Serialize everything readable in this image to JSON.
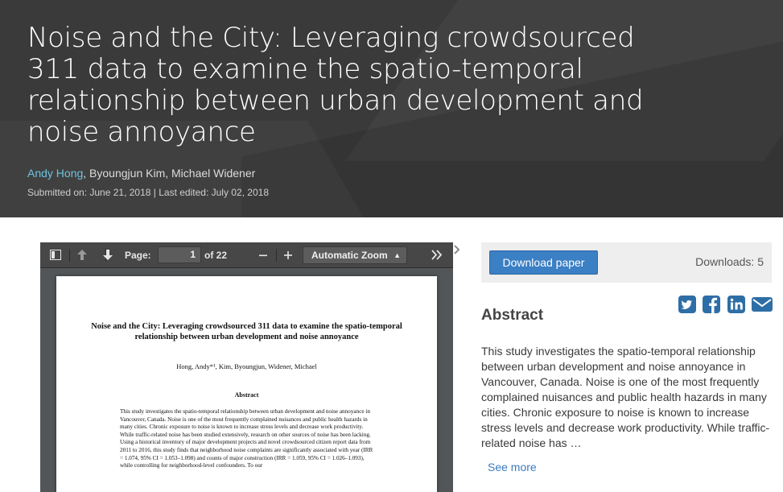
{
  "paper": {
    "title": "Noise and the City: Leveraging crowdsourced 311 data to examine the spatio-temporal relationship between urban development and noise annoyance",
    "authors_lead": "Andy Hong",
    "authors_rest": ", Byoungjun Kim, Michael Widener",
    "submitted": "Submitted on: June 21, 2018 | Last edited: July 02, 2018"
  },
  "viewer": {
    "page_label": "Page:",
    "page_value": "1",
    "page_total": "of 22",
    "zoom": "Automatic Zoom",
    "icons": [
      "sidebar-toggle-icon",
      "previous-page-icon",
      "next-page-icon",
      "zoom-out-icon",
      "zoom-in-icon",
      "tools-icon"
    ]
  },
  "pdf": {
    "title": "Noise and the City: Leveraging crowdsourced 311 data to examine the spatio-temporal relationship between urban development and noise annoyance",
    "authors": "Hong, Andy*¹, Kim, Byoungjun, Widener, Michael",
    "abstract_heading": "Abstract",
    "abstract_body": "This study investigates the spatio-temporal relationship between urban development and noise annoyance in Vancouver, Canada. Noise is one of the most frequently complained nuisances and public health hazards in many cities. Chronic exposure to noise is known to increase stress levels and decrease work productivity. While traffic-related noise has been studied extensively, research on other sources of noise has been lacking. Using a historical inventory of major development projects and novel crowdsourced citizen report data from 2011 to 2016, this study finds that neighborhood noise complaints are significantly associated with year (IRR = 1.074, 95% CI = 1.053–1.098) and counts of major construction (IRR = 1.059, 95% CI = 1.026–1.093), while controlling for neighborhood-level confounders. To our"
  },
  "sidebar": {
    "download_label": "Download paper",
    "downloads": "Downloads: 5",
    "share_icons": [
      "twitter-icon",
      "facebook-icon",
      "linkedin-icon",
      "email-icon"
    ],
    "abstract_heading": "Abstract",
    "abstract_text": "This study investigates the spatio-temporal relationship between urban development and noise annoyance in Vancouver, Canada. Noise is one of the most frequently complained nuisances and public health hazards in many cities. Chronic exposure to noise is known to increase stress levels and decrease work productivity. While traffic-related noise has …",
    "see_more": "See more"
  },
  "colors": {
    "hero_bg": "#3a3a3a",
    "author_link": "#6cc3df",
    "primary_button": "#3b7fc4",
    "link": "#3a7bbf",
    "share_icon": "#2e6ea6"
  }
}
